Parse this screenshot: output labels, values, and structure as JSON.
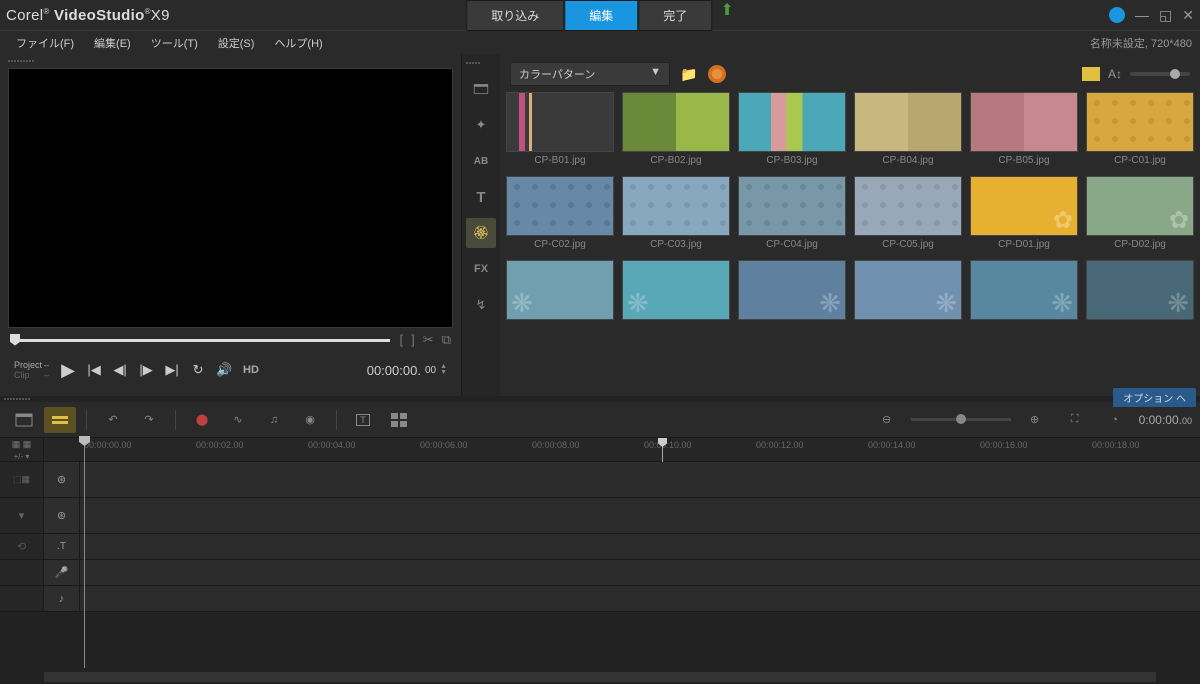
{
  "app": {
    "brand": "Corel",
    "name1": "VideoStudio",
    "name2": "X9"
  },
  "mainTabs": [
    {
      "label": "取り込み"
    },
    {
      "label": "編集"
    },
    {
      "label": "完了"
    }
  ],
  "activeMainTab": 1,
  "menus": [
    {
      "label": "ファイル(F)"
    },
    {
      "label": "編集(E)"
    },
    {
      "label": "ツール(T)"
    },
    {
      "label": "設定(S)"
    },
    {
      "label": "ヘルプ(H)"
    }
  ],
  "project": {
    "status": "名称未設定, 720*480"
  },
  "preview": {
    "modeLabels": {
      "project": "Project",
      "clip": "Clip"
    },
    "hd": "HD",
    "timecode": "00:00:00.",
    "frames": "00"
  },
  "library": {
    "dropdown": "カラーパターン",
    "thumbs": [
      [
        {
          "l": "CP-B01.jpg",
          "c": "p-b01"
        },
        {
          "l": "CP-B02.jpg",
          "c": "p-b02"
        },
        {
          "l": "CP-B03.jpg",
          "c": "p-b03"
        },
        {
          "l": "CP-B04.jpg",
          "c": "p-b04"
        },
        {
          "l": "CP-B05.jpg",
          "c": "p-b05"
        },
        {
          "l": "CP-C01.jpg",
          "c": "p-c01"
        }
      ],
      [
        {
          "l": "CP-C02.jpg",
          "c": "p-c02"
        },
        {
          "l": "CP-C03.jpg",
          "c": "p-c03"
        },
        {
          "l": "CP-C04.jpg",
          "c": "p-c04"
        },
        {
          "l": "CP-C05.jpg",
          "c": "p-c05"
        },
        {
          "l": "CP-D01.jpg",
          "c": "p-d01"
        },
        {
          "l": "CP-D02.jpg",
          "c": "p-d02"
        }
      ],
      [
        {
          "l": "",
          "c": "p-d03"
        },
        {
          "l": "",
          "c": "p-d04"
        },
        {
          "l": "",
          "c": "p-d05"
        },
        {
          "l": "",
          "c": "p-d06"
        },
        {
          "l": "",
          "c": "p-d07"
        },
        {
          "l": "",
          "c": "p-d08"
        }
      ]
    ]
  },
  "optionsLabel": "オプション ヘ",
  "timeline": {
    "timecode": "0:00:00.",
    "frames": "00",
    "ticks": [
      "00:00:00.00",
      "00:00:02.00",
      "00:00:04.00",
      "00:00:06.00",
      "00:00:08.00",
      "00:00:10.00",
      "00:00:12.00",
      "00:00:14.00",
      "00:00:16.00",
      "00:00:18.00"
    ]
  }
}
